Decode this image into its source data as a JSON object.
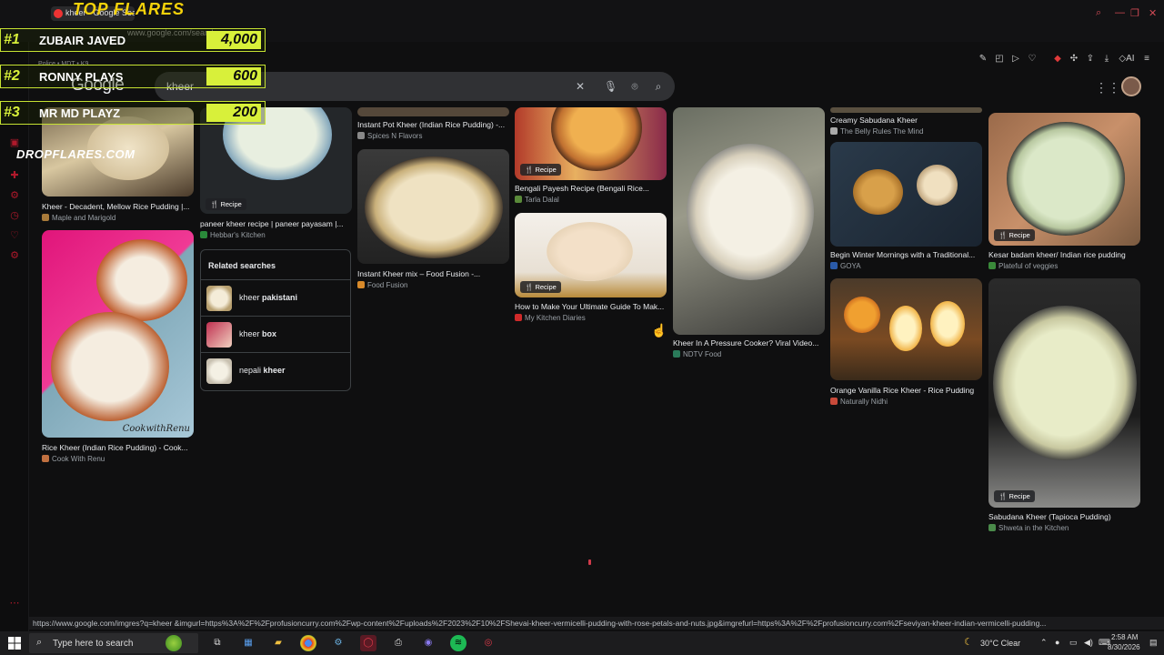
{
  "browser": {
    "tab_title": "kheer - Google Search",
    "url": "www.google.com/search",
    "extension_text": "Police • MDT • K9..."
  },
  "overlay": {
    "title": "TOP FLARES",
    "leaders": [
      {
        "rank": "#1",
        "name": "ZUBAIR JAVED",
        "score": "4,000"
      },
      {
        "rank": "#2",
        "name": "RONNY PLAYS",
        "score": "600"
      },
      {
        "rank": "#3",
        "name": "MR MD PLAYZ",
        "score": "200"
      }
    ],
    "brand": "DROPFLARES.COM"
  },
  "google": {
    "logo": "Google",
    "query": "kheer"
  },
  "cards": [
    {
      "caption": "Kheer - Decadent, Mellow Rice Pudding |...",
      "source": "Maple and Marigold"
    },
    {
      "caption": "Rice Kheer (Indian Rice Pudding) - Cook...",
      "source": "Cook With Renu",
      "watermark": "CookwithRenu"
    },
    {
      "caption": "paneer kheer recipe | paneer payasam |...",
      "source": "Hebbar's Kitchen",
      "badge": "Recipe"
    },
    {
      "caption": "Instant Pot Kheer (Indian Rice Pudding) -...",
      "source": "Spices N Flavors"
    },
    {
      "caption": "Instant Kheer mix – Food Fusion -...",
      "source": "Food Fusion"
    },
    {
      "caption": "Bengali Payesh Recipe (Bengali Rice...",
      "source": "Tarla Dalal",
      "badge": "Recipe"
    },
    {
      "caption": "How to Make Your Ultimate Guide To Mak...",
      "source": "My Kitchen Diaries",
      "badge": "Recipe"
    },
    {
      "caption": "Kheer In A Pressure Cooker? Viral Video...",
      "source": "NDTV Food"
    },
    {
      "caption": "Creamy Sabudana Kheer",
      "source": "The Belly Rules The Mind"
    },
    {
      "caption": "Begin Winter Mornings with a Traditional...",
      "source": "GOYA"
    },
    {
      "caption": "Orange Vanilla Rice Kheer - Rice Pudding",
      "source": "Naturally Nidhi"
    },
    {
      "caption": "Kesar badam kheer/ Indian rice pudding",
      "source": "Plateful of veggies",
      "badge": "Recipe"
    },
    {
      "caption": "Sabudana Kheer (Tapioca Pudding)",
      "source": "Shweta in the Kitchen",
      "badge": "Recipe"
    }
  ],
  "related": {
    "title": "Related searches",
    "items": [
      {
        "prefix": "kheer ",
        "bold": "pakistani"
      },
      {
        "prefix": "kheer ",
        "bold": "box"
      },
      {
        "prefix": "nepali ",
        "bold": "kheer"
      }
    ]
  },
  "status_url": "https://www.google.com/imgres?q=kheer &imgurl=https%3A%2F%2Fprofusioncurry.com%2Fwp-content%2Fuploads%2F2023%2F10%2FShevai-kheer-vermicelli-pudding-with-rose-petals-and-nuts.jpg&imgrefurl=https%3A%2F%2Fprofusioncurry.com%2Fseviyan-kheer-indian-vermicelli-pudding...",
  "taskbar": {
    "search_placeholder": "Type here to search",
    "weather": "30°C  Clear",
    "time": "2:58 AM",
    "date": "8/30/2026"
  },
  "colors": {
    "overlay_accent": "#d8f03a",
    "opera_red": "#b0192b"
  }
}
